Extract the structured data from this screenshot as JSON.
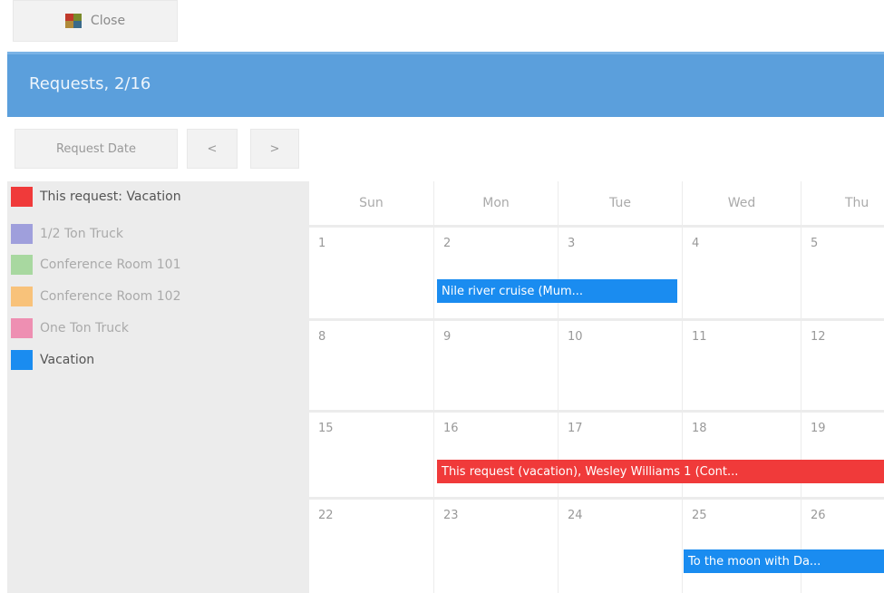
{
  "toolbar": {
    "close_label": "Close",
    "close_icon": "app-icon"
  },
  "header": {
    "title": "Requests, 2/16"
  },
  "nav": {
    "request_date_label": "Request Date",
    "prev_label": "<",
    "next_label": ">"
  },
  "legend": [
    {
      "label": "This request: Vacation",
      "color": "#f03a3a"
    },
    {
      "label": "1/2 Ton Truck",
      "color": "#9f9fdc"
    },
    {
      "label": "Conference Room 101",
      "color": "#a8d8a0"
    },
    {
      "label": "Conference Room 102",
      "color": "#f8c27a"
    },
    {
      "label": "One Ton Truck",
      "color": "#ee8fb2"
    },
    {
      "label": "Vacation",
      "color": "#1a8cf0"
    }
  ],
  "calendar": {
    "days": [
      "Sun",
      "Mon",
      "Tue",
      "Wed",
      "Thu"
    ],
    "weeks": [
      [
        "1",
        "2",
        "3",
        "4",
        "5"
      ],
      [
        "8",
        "9",
        "10",
        "11",
        "12"
      ],
      [
        "15",
        "16",
        "17",
        "18",
        "19"
      ],
      [
        "22",
        "23",
        "24",
        "25",
        "26"
      ]
    ],
    "events": [
      {
        "text": "Nile river cruise (Mum...",
        "color": "#1a8cf0"
      },
      {
        "text": "This request (vacation), Wesley Williams 1 (Cont...",
        "color": "#f03a3a"
      },
      {
        "text": "To the moon with Da...",
        "color": "#1a8cf0"
      }
    ]
  }
}
